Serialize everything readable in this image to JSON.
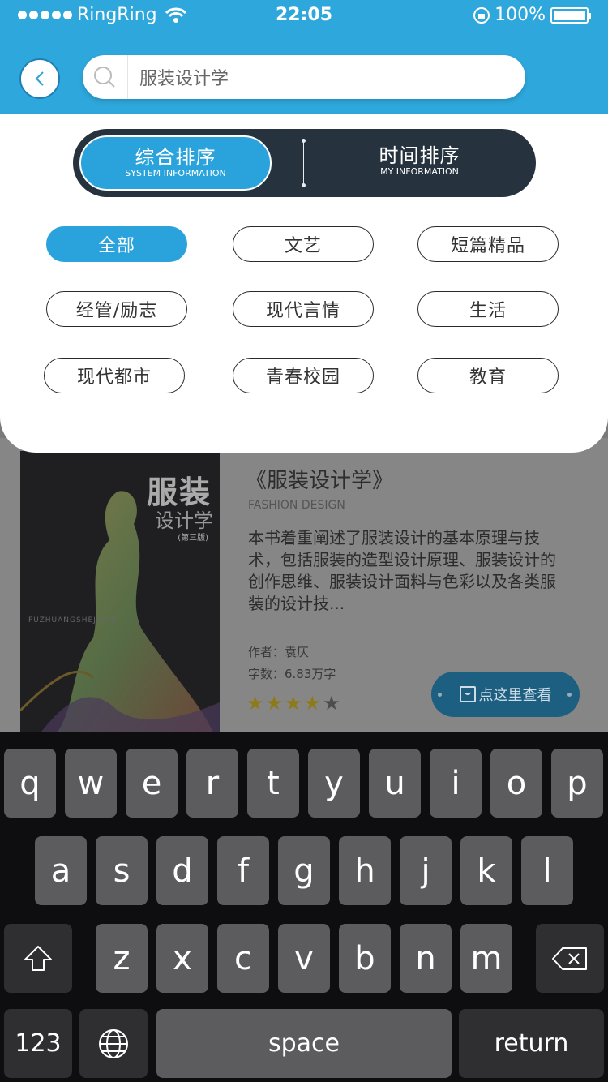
{
  "status_bar": {
    "carrier": "RingRing",
    "time": "22:05",
    "battery": "100%"
  },
  "search": {
    "query": "服装设计学"
  },
  "sort_tabs": [
    {
      "label": "综合排序",
      "sublabel": "SYSTEM INFORMATION",
      "active": true
    },
    {
      "label": "时间排序",
      "sublabel": "MY INFORMATION",
      "active": false
    }
  ],
  "categories": [
    {
      "label": "全部",
      "active": true
    },
    {
      "label": "文艺",
      "active": false
    },
    {
      "label": "短篇精品",
      "active": false
    },
    {
      "label": "经管/励志",
      "active": false
    },
    {
      "label": "现代言情",
      "active": false
    },
    {
      "label": "生活",
      "active": false
    },
    {
      "label": "现代都市",
      "active": false
    },
    {
      "label": "青春校园",
      "active": false
    },
    {
      "label": "教育",
      "active": false
    }
  ],
  "book": {
    "title": "《服装设计学》",
    "subtitle": "FASHION DESIGN",
    "description": "本书着重阐述了服装设计的基本原理与技术，包括服装的造型设计原理、服装设计的创作思维、服装设计面料与色彩以及各类服装的设计技...",
    "author": "作者：袁仄",
    "words": "字数：6.83万字",
    "rating": 4,
    "rating_max": 5,
    "view_button": "点这里查看",
    "cover": {
      "title": "服装",
      "subtitle": "设计学",
      "edition": "(第三版)",
      "pinyin": "FUZHUANGSHEJIXUE"
    }
  },
  "keyboard": {
    "row1": [
      "q",
      "w",
      "e",
      "r",
      "t",
      "y",
      "u",
      "i",
      "o",
      "p"
    ],
    "row2": [
      "a",
      "s",
      "d",
      "f",
      "g",
      "h",
      "j",
      "k",
      "l"
    ],
    "row3": [
      "z",
      "x",
      "c",
      "v",
      "b",
      "n",
      "m"
    ],
    "numbers_key": "123",
    "space_key": "space",
    "return_key": "return"
  },
  "colors": {
    "accent": "#2ea7dc",
    "toggle_bg": "#26333f",
    "keyboard_bg": "#0e0e10"
  }
}
